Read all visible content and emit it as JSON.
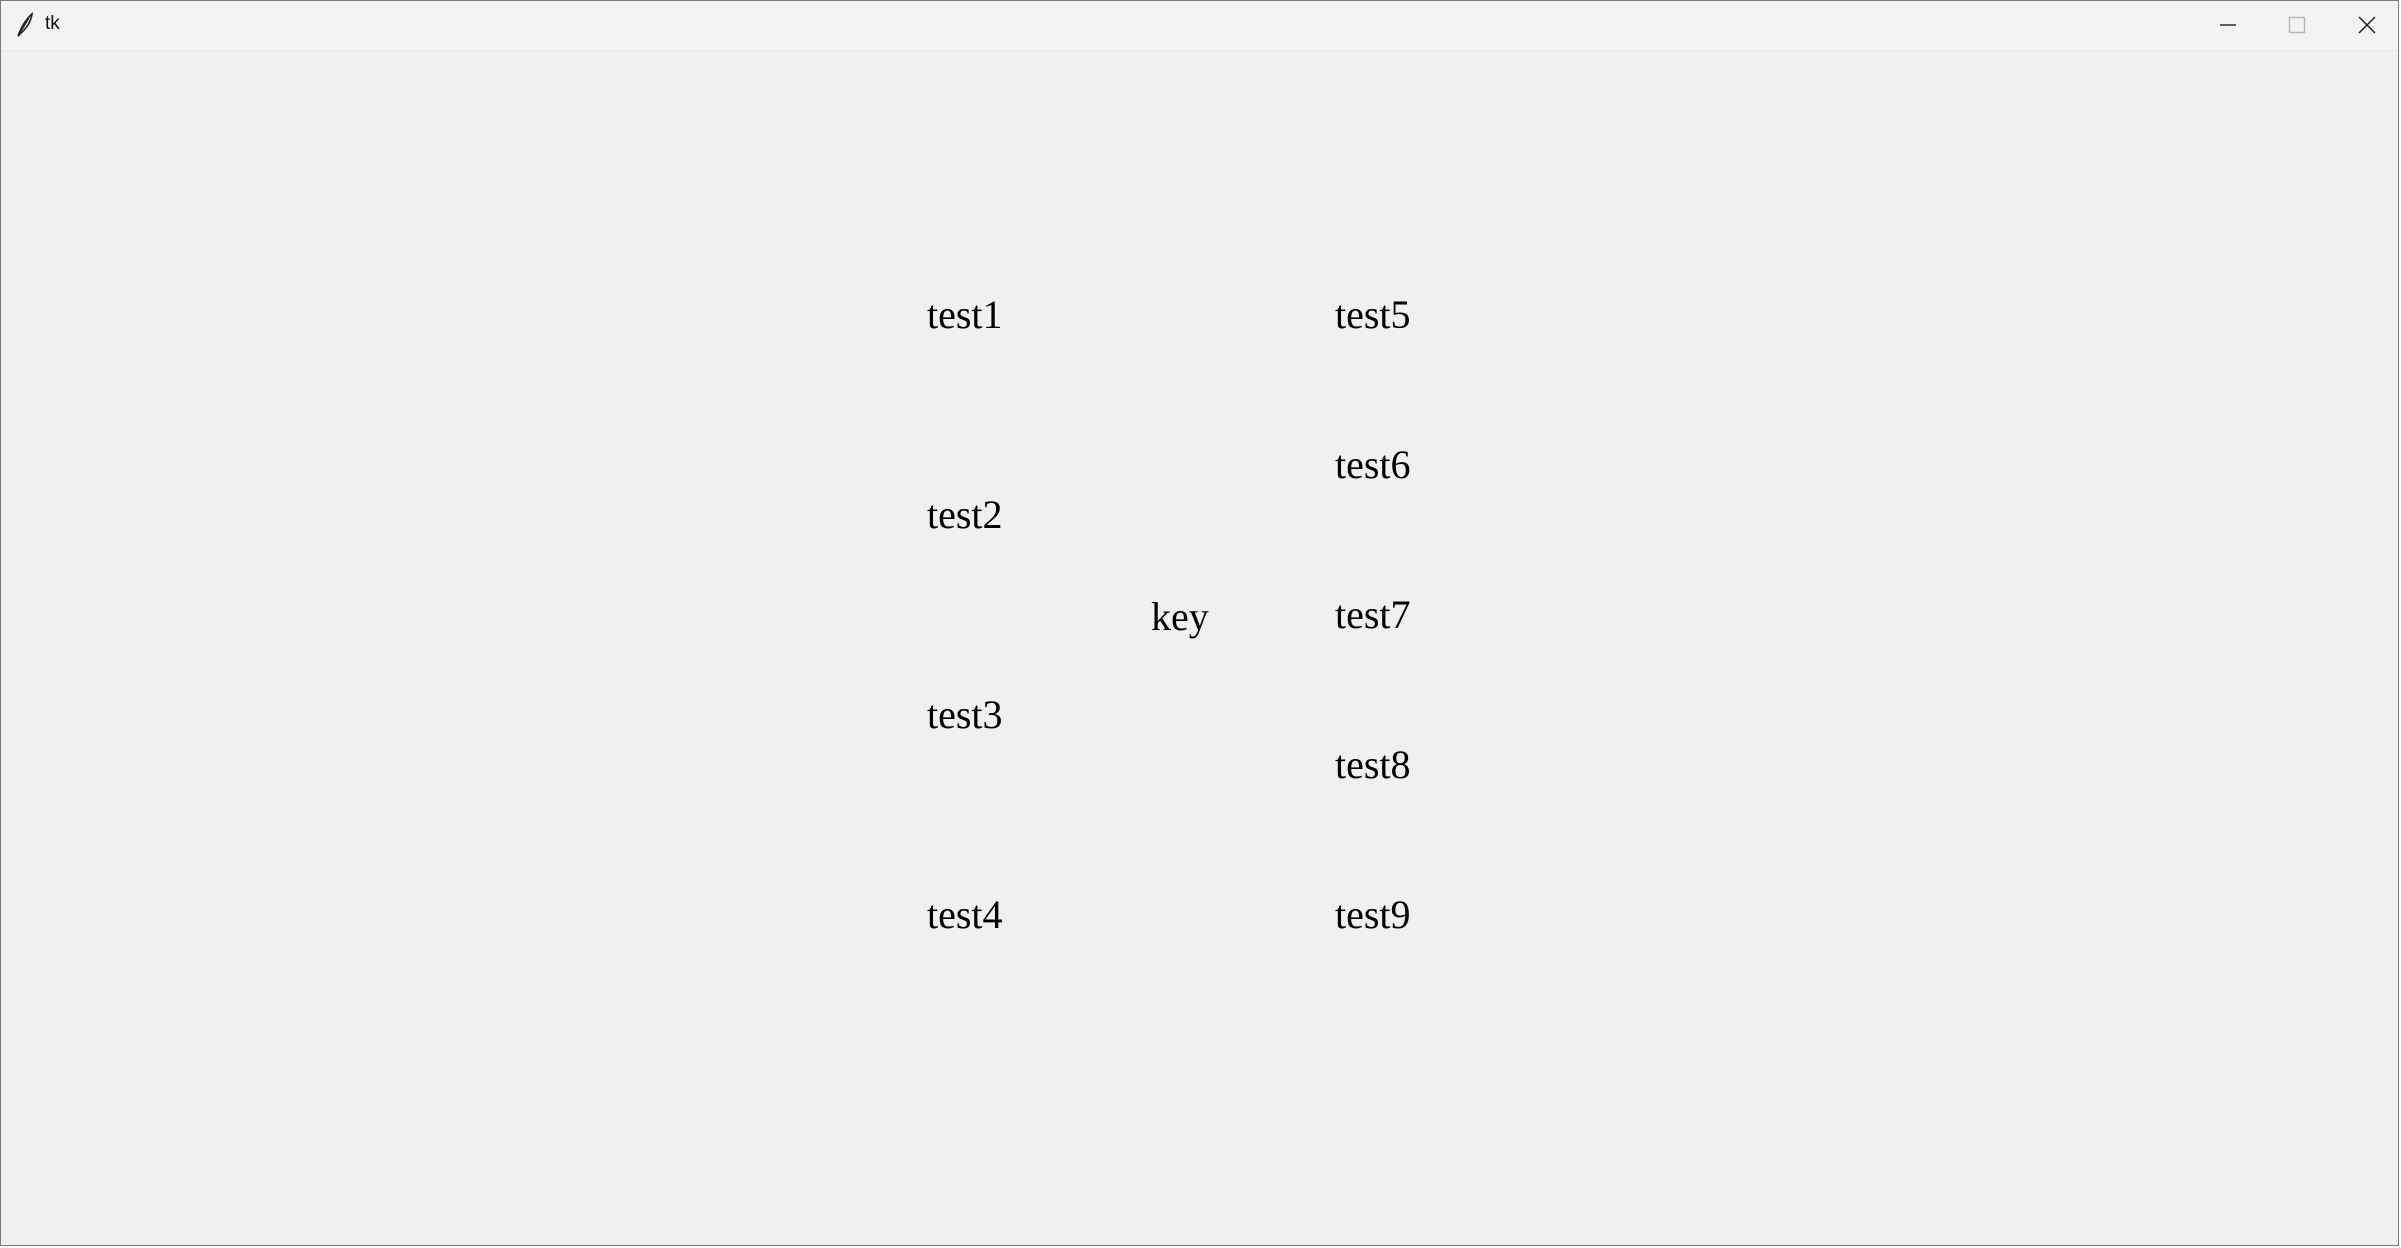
{
  "window": {
    "title": "tk",
    "icon": "tk-feather-icon",
    "controls": {
      "minimize": "minimize-icon",
      "maximize": "maximize-icon",
      "close": "close-icon"
    }
  },
  "labels": {
    "left_column": [
      "test1",
      "test2",
      "test3",
      "test4"
    ],
    "center": "key",
    "right_column": [
      "test5",
      "test6",
      "test7",
      "test8",
      "test9"
    ]
  },
  "colors": {
    "background": "#f0f0f0",
    "text": "#000000"
  }
}
